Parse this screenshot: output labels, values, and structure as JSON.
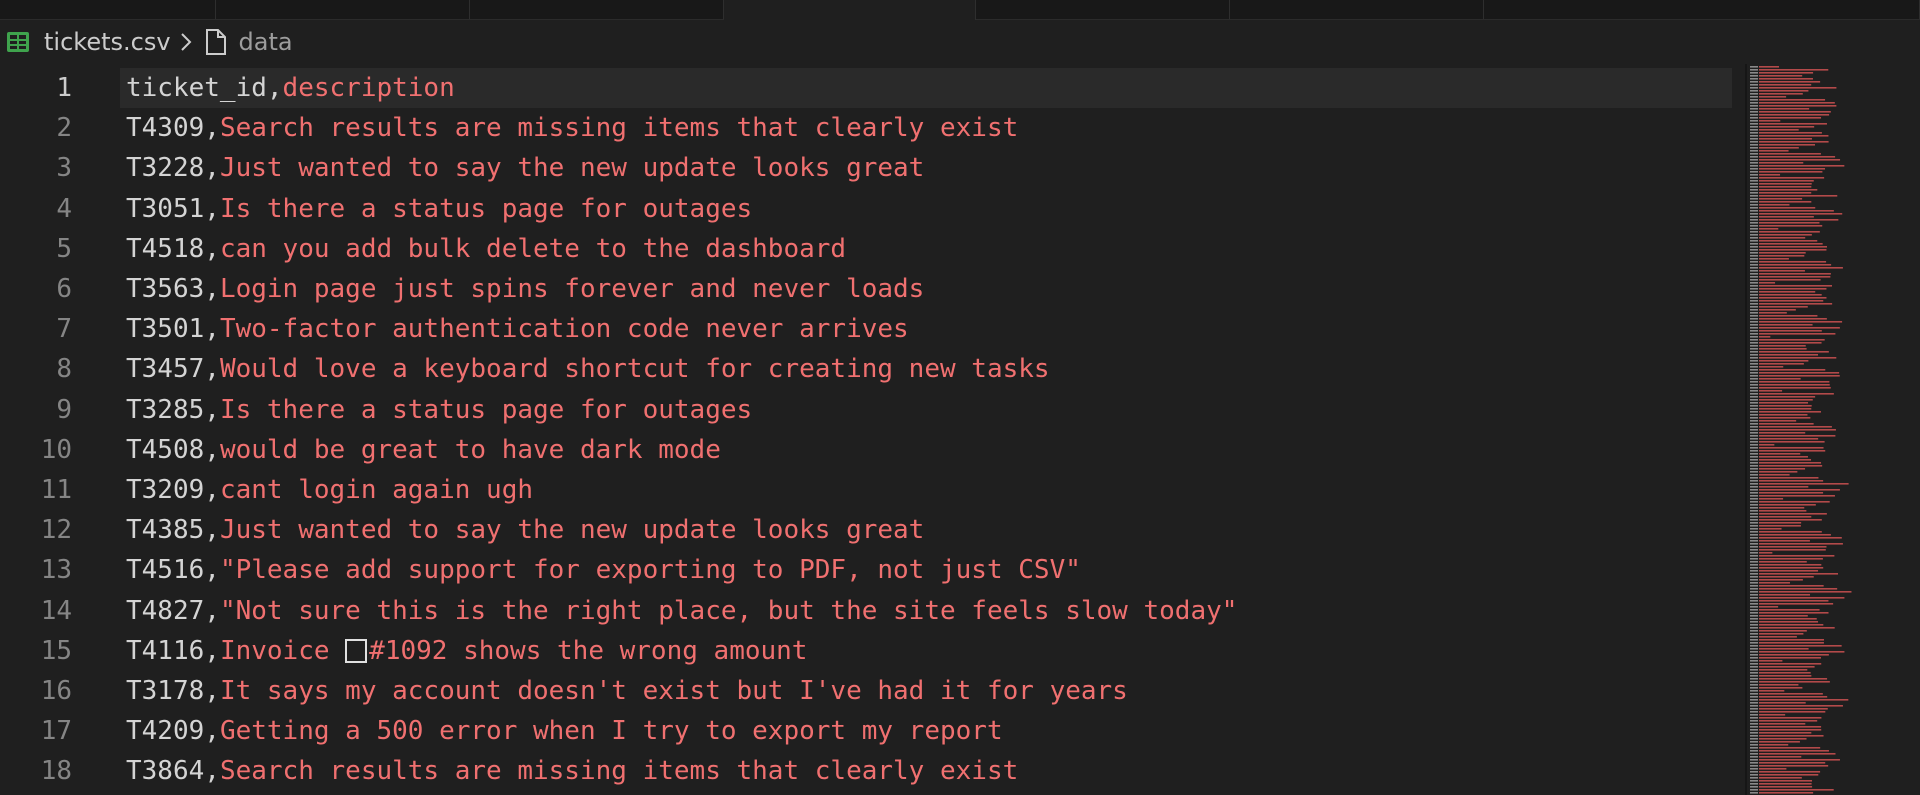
{
  "breadcrumb": {
    "file_name": "tickets.csv",
    "symbol": "data",
    "file_icon_color": "#3fa34d"
  },
  "editor": {
    "colors": {
      "first_column": "#d4d4d4",
      "second_column": "#f07070",
      "line_number": "#858585",
      "background": "#1f1f1f"
    },
    "lines": [
      {
        "number": "1",
        "col0": "ticket_id",
        "col1": "description"
      },
      {
        "number": "2",
        "col0": "T4309",
        "col1": "Search results are missing items that clearly exist"
      },
      {
        "number": "3",
        "col0": "T3228",
        "col1": "Just wanted to say the new update looks great"
      },
      {
        "number": "4",
        "col0": "T3051",
        "col1": "Is there a status page for outages"
      },
      {
        "number": "5",
        "col0": "T4518",
        "col1": "can you add bulk delete to the dashboard"
      },
      {
        "number": "6",
        "col0": "T3563",
        "col1": "Login page just spins forever and never loads"
      },
      {
        "number": "7",
        "col0": "T3501",
        "col1": "Two-factor authentication code never arrives"
      },
      {
        "number": "8",
        "col0": "T3457",
        "col1": "Would love a keyboard shortcut for creating new tasks"
      },
      {
        "number": "9",
        "col0": "T3285",
        "col1": "Is there a status page for outages"
      },
      {
        "number": "10",
        "col0": "T4508",
        "col1": "would be great to have dark mode"
      },
      {
        "number": "11",
        "col0": "T3209",
        "col1": "cant login again ugh"
      },
      {
        "number": "12",
        "col0": "T4385",
        "col1": "Just wanted to say the new update looks great"
      },
      {
        "number": "13",
        "col0": "T4516",
        "col1": "\"Please add support for exporting to PDF, not just CSV\""
      },
      {
        "number": "14",
        "col0": "T4827",
        "col1": "\"Not sure this is the right place, but the site feels slow today\""
      },
      {
        "number": "15",
        "col0": "T4116",
        "col1_before": "Invoice ",
        "col1_after": "#1092 shows the wrong amount"
      },
      {
        "number": "16",
        "col0": "T3178",
        "col1": "It says my account doesn't exist but I've had it for years"
      },
      {
        "number": "17",
        "col0": "T4209",
        "col1": "Getting a 500 error when I try to export my report"
      },
      {
        "number": "18",
        "col0": "T3864",
        "col1": "Search results are missing items that clearly exist"
      }
    ]
  },
  "minimap": {
    "line_color": "#b34a4a",
    "header_color": "#8a8a8a"
  }
}
